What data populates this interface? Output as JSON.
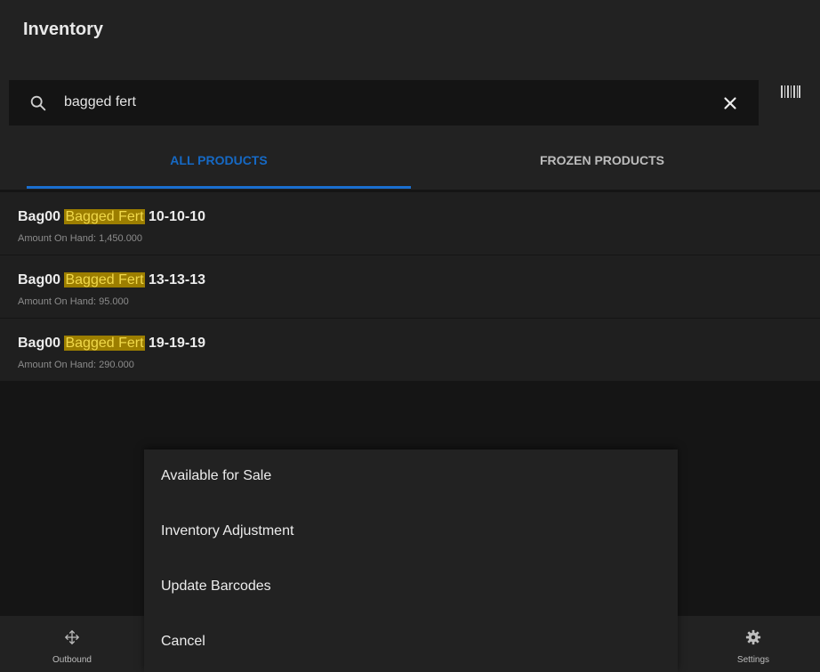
{
  "header": {
    "title": "Inventory"
  },
  "search": {
    "query": "bagged fert",
    "icon": "search-icon",
    "clear_icon": "close-icon",
    "barcode_icon": "barcode-icon"
  },
  "tabs": [
    {
      "label": "ALL PRODUCTS",
      "active": true
    },
    {
      "label": "FROZEN PRODUCTS",
      "active": false
    }
  ],
  "products": [
    {
      "prefix": "Bag00",
      "match": "Bagged Fert",
      "suffix": "10-10-10",
      "amount": "Amount On Hand: 1,450.000"
    },
    {
      "prefix": "Bag00",
      "match": "Bagged Fert",
      "suffix": "13-13-13",
      "amount": "Amount On Hand: 95.000"
    },
    {
      "prefix": "Bag00",
      "match": "Bagged Fert",
      "suffix": "19-19-19",
      "amount": "Amount On Hand: 290.000"
    }
  ],
  "action_sheet": {
    "items": [
      "Available for Sale",
      "Inventory Adjustment",
      "Update Barcodes",
      "Cancel"
    ]
  },
  "bottom_nav": {
    "outbound_label": "Outbound",
    "settings_label": "Settings"
  },
  "colors": {
    "accent": "#1669c4",
    "highlight_bg": "#9c7e00",
    "highlight_text": "#f0d84a"
  }
}
